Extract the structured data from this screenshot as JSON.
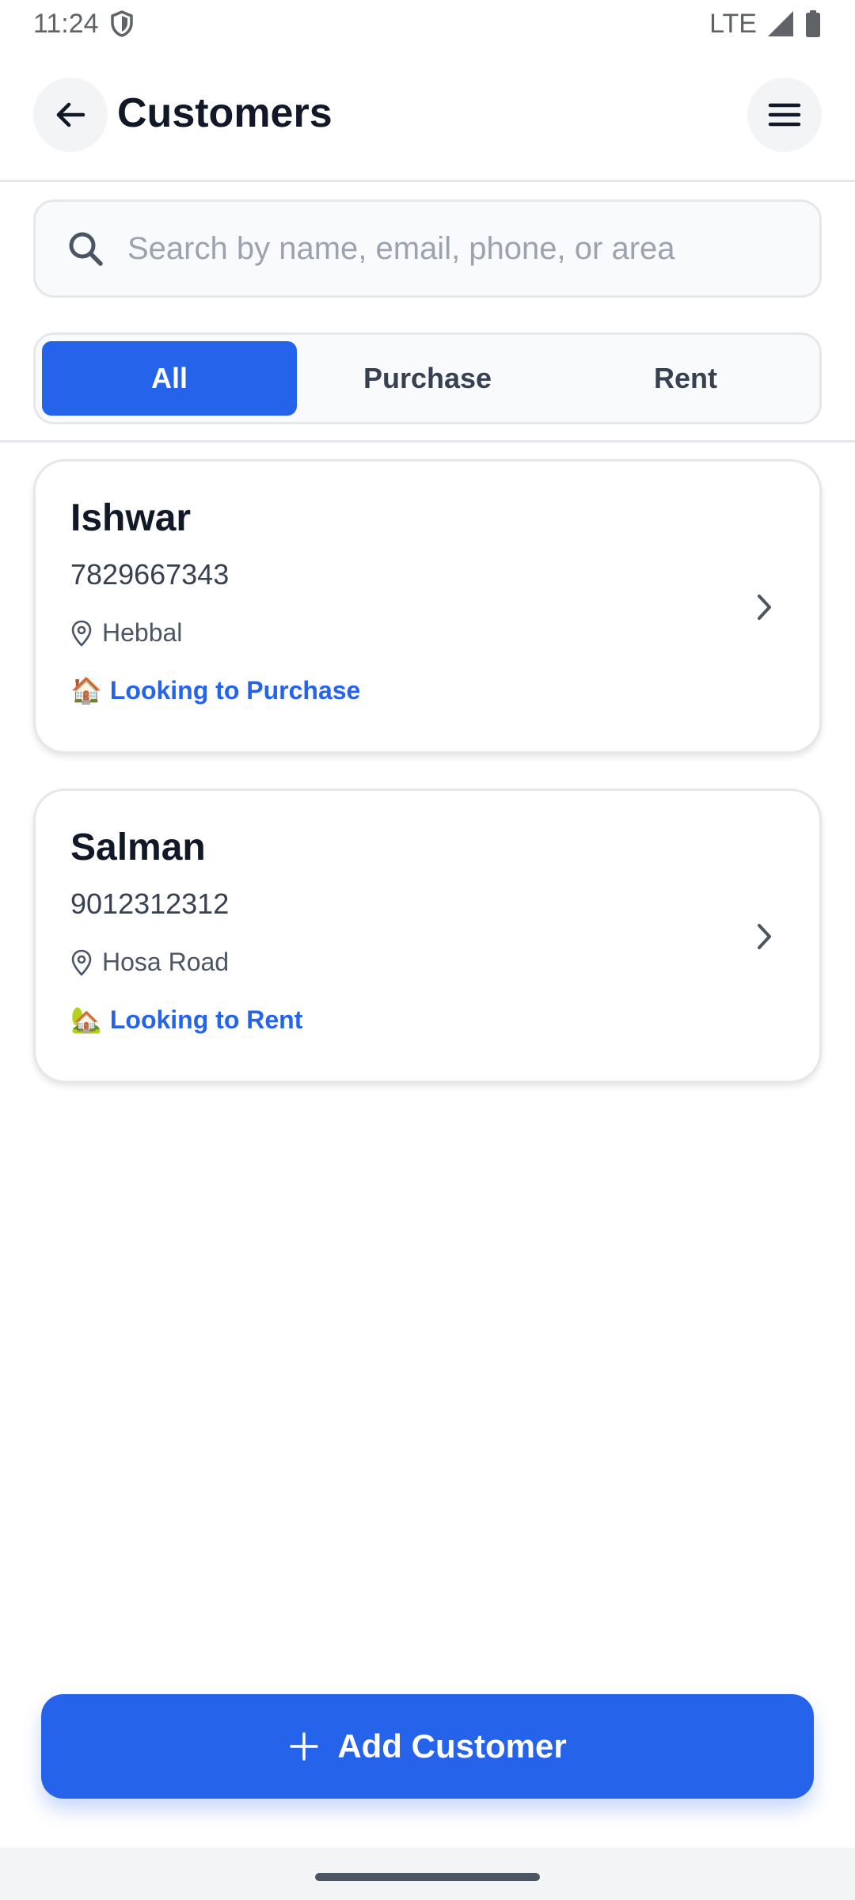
{
  "status_bar": {
    "time": "11:24",
    "network": "LTE"
  },
  "header": {
    "title": "Customers"
  },
  "search": {
    "placeholder": "Search by name, email, phone, or area",
    "value": ""
  },
  "tabs": [
    {
      "label": "All",
      "active": true
    },
    {
      "label": "Purchase",
      "active": false
    },
    {
      "label": "Rent",
      "active": false
    }
  ],
  "customers": [
    {
      "name": "Ishwar",
      "phone": "7829667343",
      "area": "Hebbal",
      "interest_emoji": "🏠",
      "interest": "Looking to Purchase"
    },
    {
      "name": "Salman",
      "phone": "9012312312",
      "area": "Hosa Road",
      "interest_emoji": "🏡",
      "interest": "Looking to Rent"
    }
  ],
  "add_button": {
    "label": "Add Customer"
  },
  "colors": {
    "primary": "#2563eb",
    "text": "#111827",
    "border": "#e5e7eb"
  },
  "icons": {
    "back": "arrow-left-icon",
    "menu": "hamburger-menu-icon",
    "search": "search-icon",
    "location": "map-pin-icon",
    "chevron": "chevron-right-icon",
    "add": "plus-icon"
  }
}
